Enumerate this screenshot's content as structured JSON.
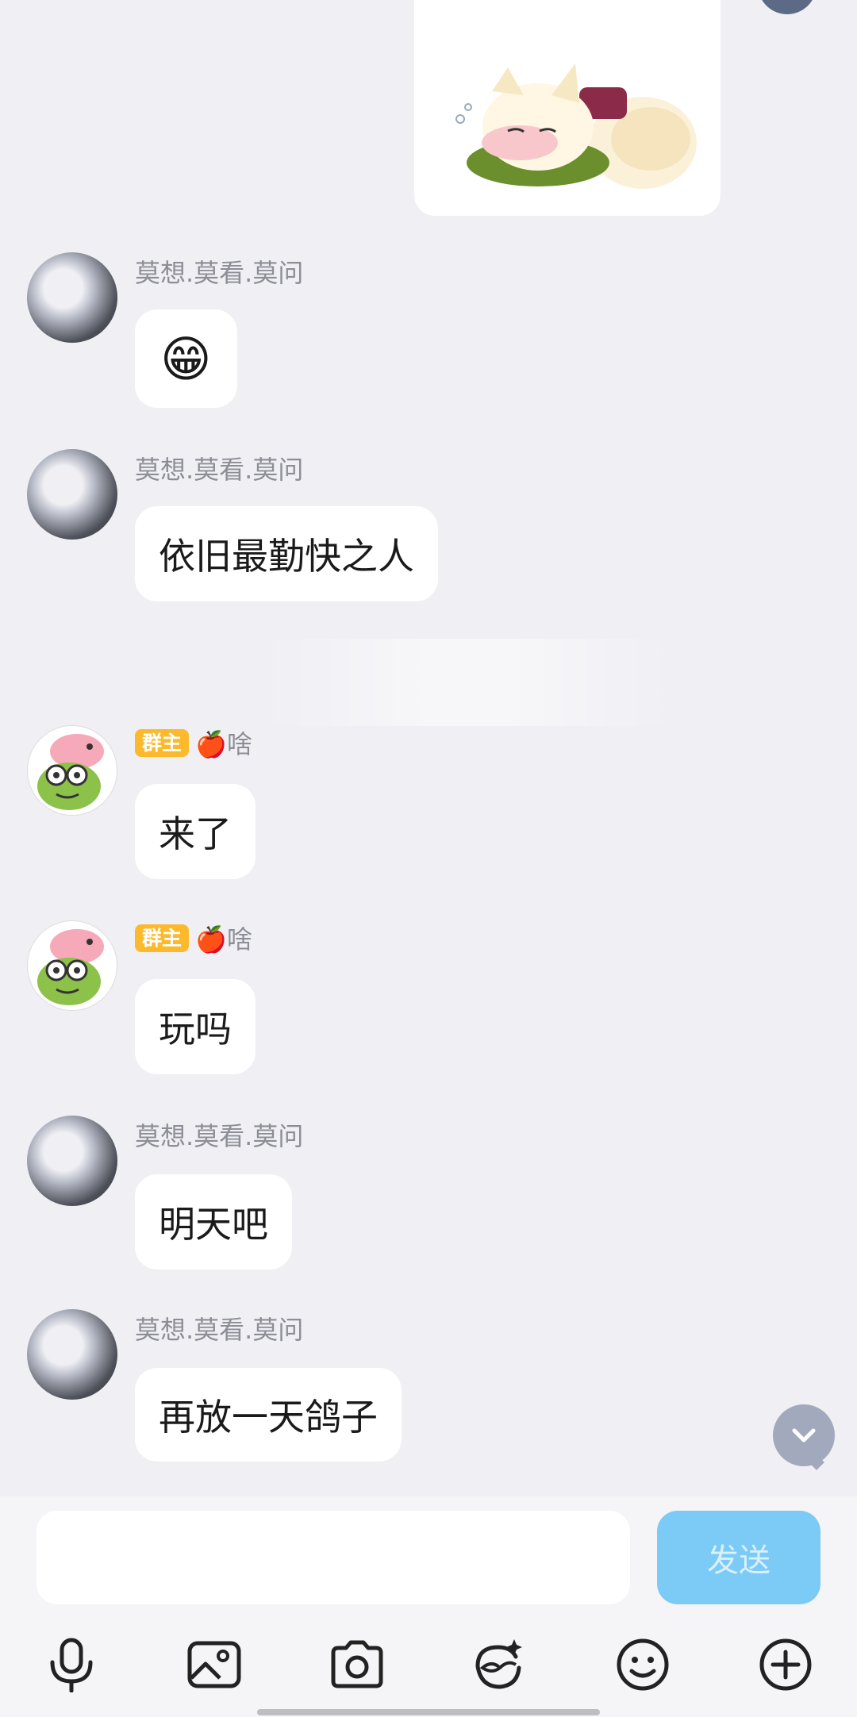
{
  "messages": [
    {
      "sender": "莫想.莫看.莫问",
      "owner": false,
      "text": "😁",
      "kind": "emoji"
    },
    {
      "sender": "莫想.莫看.莫问",
      "owner": false,
      "text": "依旧最勤快之人",
      "kind": "text"
    },
    {
      "sender": "🍎啥",
      "owner_badge": "群主",
      "owner": true,
      "text": "来了",
      "kind": "text"
    },
    {
      "sender": "🍎啥",
      "owner_badge": "群主",
      "owner": true,
      "text": "玩吗",
      "kind": "text"
    },
    {
      "sender": "莫想.莫看.莫问",
      "owner": false,
      "text": "明天吧",
      "kind": "text"
    },
    {
      "sender": "莫想.莫看.莫问",
      "owner": false,
      "text": "再放一天鸽子",
      "kind": "text"
    }
  ],
  "composer": {
    "input_value": "",
    "send_label": "发送"
  },
  "toolbar_icons": [
    "microphone-icon",
    "image-icon",
    "camera-icon",
    "ai-face-icon",
    "emoji-icon",
    "plus-icon"
  ],
  "colors": {
    "background": "#efeff4",
    "bubble": "#ffffff",
    "send_button": "#7ccaf6",
    "owner_badge": "#fcb92c"
  }
}
